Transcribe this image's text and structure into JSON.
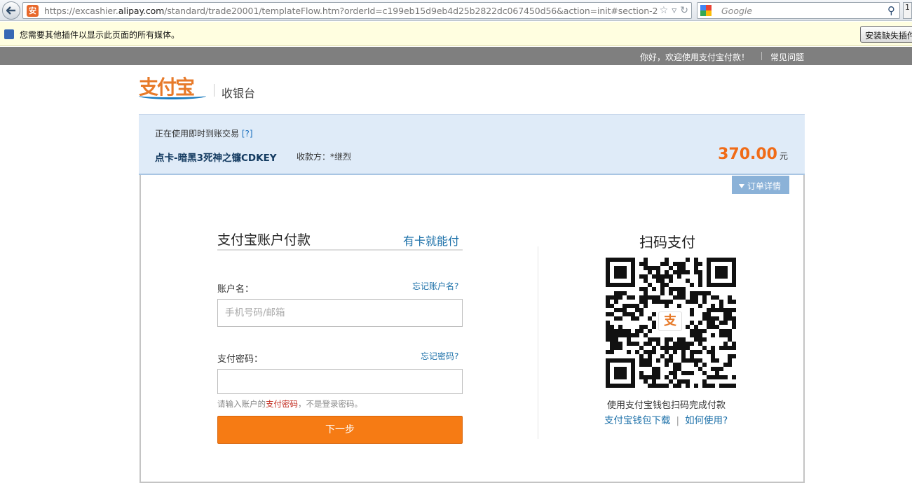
{
  "browser": {
    "url_prefix": "https://excashier.",
    "url_domain": "alipay.com",
    "url_suffix": "/standard/trade20001/templateFlow.htm?orderId=c199eb15d9eb4d25b2822dc067450d56&action=init#section-2",
    "search_placeholder": "Google",
    "site_badge": "安",
    "tab_edge": "1"
  },
  "plugin_bar": {
    "message": "您需要其他插件以显示此页面的所有媒体。",
    "install_label": "安装缺失插件"
  },
  "topbar": {
    "greeting": "你好，欢迎使用支付宝付款！",
    "faq": "常见问题"
  },
  "header": {
    "logo": "支付宝",
    "subtitle": "收银台"
  },
  "order": {
    "status": "正在使用即时到账交易",
    "help": "[?]",
    "title": "点卡-暗黑3死神之镰CDKEY",
    "payee": "收款方：*继烈",
    "amount": "370.00",
    "currency": "元"
  },
  "account_form": {
    "detail_label": "订单详情",
    "heading": "支付宝账户付款",
    "card_link": "有卡就能付",
    "account_label": "账户名：",
    "forgot_account": "忘记账户名?",
    "account_placeholder": "手机号码/邮箱",
    "password_label": "支付密码：",
    "forgot_password": "忘记密码?",
    "hint_prefix": "请输入账户的",
    "hint_highlight": "支付密码",
    "hint_suffix": "，不是登录密码。",
    "next_label": "下一步"
  },
  "qr_pay": {
    "heading": "扫码支付",
    "logo": "支",
    "caption": "使用支付宝钱包扫码完成付款",
    "download_link": "支付宝钱包下载",
    "separator": "|",
    "howto_link": "如何使用?"
  },
  "colors": {
    "accent_orange": "#f67b14",
    "link_blue": "#1a6fa8",
    "banner_blue": "#dfebf8"
  }
}
